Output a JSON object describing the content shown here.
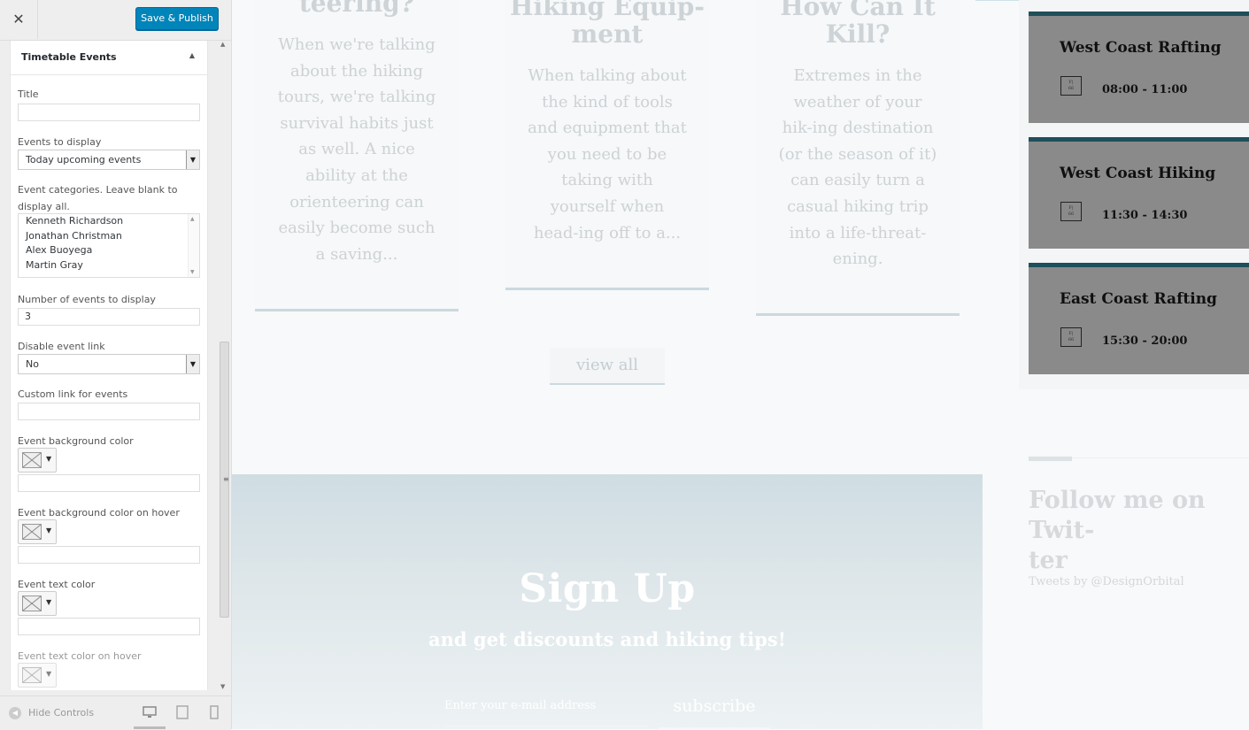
{
  "customizer": {
    "close_label": "✕",
    "save_label": "Save & Publish",
    "section_title": "Timetable Events",
    "collapse_icon": "▲",
    "fields": {
      "title_label": "Title",
      "title_value": "",
      "events_to_display_label": "Events to display",
      "events_to_display_value": "Today upcoming events",
      "categories_label": "Event categories. Leave blank to display all.",
      "categories": [
        "Kenneth Richardson",
        "Jonathan Christman",
        "Alex Buoyega",
        "Martin Gray"
      ],
      "number_label": "Number of events to display",
      "number_value": "3",
      "disable_link_label": "Disable event link",
      "disable_link_value": "No",
      "custom_link_label": "Custom link for events",
      "custom_link_value": "",
      "bg_color_label": "Event background color",
      "bg_hover_label": "Event background color on hover",
      "text_color_label": "Event text color",
      "text_hover_label": "Event text color on hover"
    },
    "footer": {
      "hide_controls_label": "Hide Controls",
      "devices": [
        "desktop-icon",
        "tablet-icon",
        "mobile-icon"
      ]
    }
  },
  "preview": {
    "cards": [
      {
        "title": "teering?",
        "body": "When we're talking about the hiking tours, we're talking survival habits just as well. A nice ability at the orienteering can easily become such a saving..."
      },
      {
        "title": "Hiking Equip-\nment",
        "body": "When talking about the kind of tools and equipment that you need to be taking with yourself when head-ing off to a..."
      },
      {
        "title": "How Can It\nKill?",
        "body": "Extremes in the weather of your hik-ing destination (or the season of it) can easily turn a casual hiking trip into a life-threat-ening."
      }
    ],
    "view_all_label": "view all",
    "signup": {
      "title": "Sign Up",
      "subtitle": "and get discounts and hiking tips!",
      "email_placeholder": "Enter your e-mail address",
      "subscribe_label": "subscribe"
    },
    "events": [
      {
        "name": "West Coast Rafting",
        "time": "08:00 - 11:00",
        "icon_text": "F|\n66"
      },
      {
        "name": "West Coast Hiking",
        "time": "11:30 - 14:30",
        "icon_text": "F|\n66"
      },
      {
        "name": "East Coast Rafting",
        "time": "15:30 - 20:00",
        "icon_text": "F|\n66"
      }
    ],
    "twitter": {
      "title": "Follow me on Twit-\nter",
      "tweets_by": "Tweets by @DesignOrbital"
    }
  },
  "colors": {
    "save_button": "#0085ba",
    "event_bg": "#8a8a8a",
    "event_border": "#1f4f5a"
  }
}
